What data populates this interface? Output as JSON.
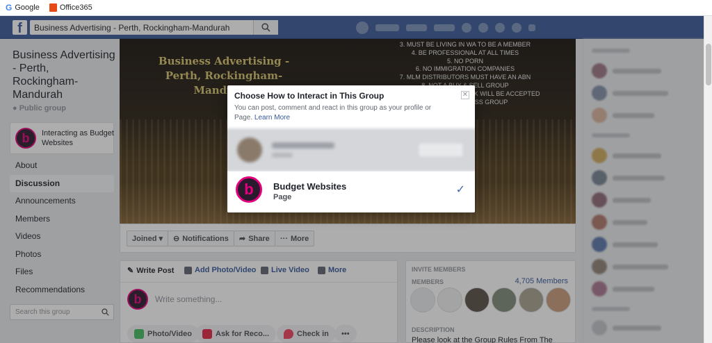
{
  "bookmarks": [
    {
      "label": "Google",
      "icon": "google-icon"
    },
    {
      "label": "Office365",
      "icon": "office365-icon"
    }
  ],
  "topbar": {
    "search_value": "Business Advertising - Perth, Rockingham-Mandurah",
    "search_icon": "⚲"
  },
  "group": {
    "title": "Business Advertising - Perth, Rockingham-Mandurah",
    "privacy": "Public group",
    "interacting_as": "Interacting as Budget Websites"
  },
  "menu": [
    {
      "label": "About",
      "active": false
    },
    {
      "label": "Discussion",
      "active": true
    },
    {
      "label": "Announcements",
      "active": false
    },
    {
      "label": "Members",
      "active": false
    },
    {
      "label": "Videos",
      "active": false
    },
    {
      "label": "Photos",
      "active": false
    },
    {
      "label": "Files",
      "active": false
    },
    {
      "label": "Recommendations",
      "active": false
    }
  ],
  "group_search_placeholder": "Search this group",
  "cover": {
    "title": "Business Advertising - Perth, Rockingham-Mandurah",
    "rules": [
      "3. MUST BE LIVING IN WA TO BE A MEMBER",
      "4. BE PROFESSIONAL AT ALL TIMES",
      "5. NO PORN",
      "6. NO IMMIGRATION COMPANIES",
      "7. MLM DISTRIBUTORS MUST HAVE AN ABN",
      "8. NOT A BUY & SELL GROUP",
      "9. ONLY ONE BUSINESS LINK WILL BE ACCEPTED",
      "THIS IS A BUSINESS GROUP"
    ]
  },
  "actions": {
    "joined": "Joined ▾",
    "notifications": "Notifications",
    "share": "Share",
    "more": "More"
  },
  "composer": {
    "tabs": [
      "Write Post",
      "Add Photo/Video",
      "Live Video",
      "More"
    ],
    "placeholder": "Write something...",
    "pills": [
      "Photo/Video",
      "Ask for Reco...",
      "Check in",
      "•••"
    ]
  },
  "invite": {
    "header": "INVITE MEMBERS",
    "members_label": "MEMBERS",
    "members_count": "4,705 Members",
    "description_label": "DESCRIPTION",
    "description": "Please look at the Group Rules From The"
  },
  "dialog": {
    "title": "Choose How to Interact in This Group",
    "subtitle": "You can post, comment and react in this group as your profile or Page.",
    "learn_more": "Learn More",
    "page_name": "Budget Websites",
    "page_type": "Page",
    "check": "✓",
    "close": "✕"
  },
  "colors": {
    "facebook_blue": "#3b5998",
    "brand_pink": "#e6007e",
    "link": "#365899"
  }
}
